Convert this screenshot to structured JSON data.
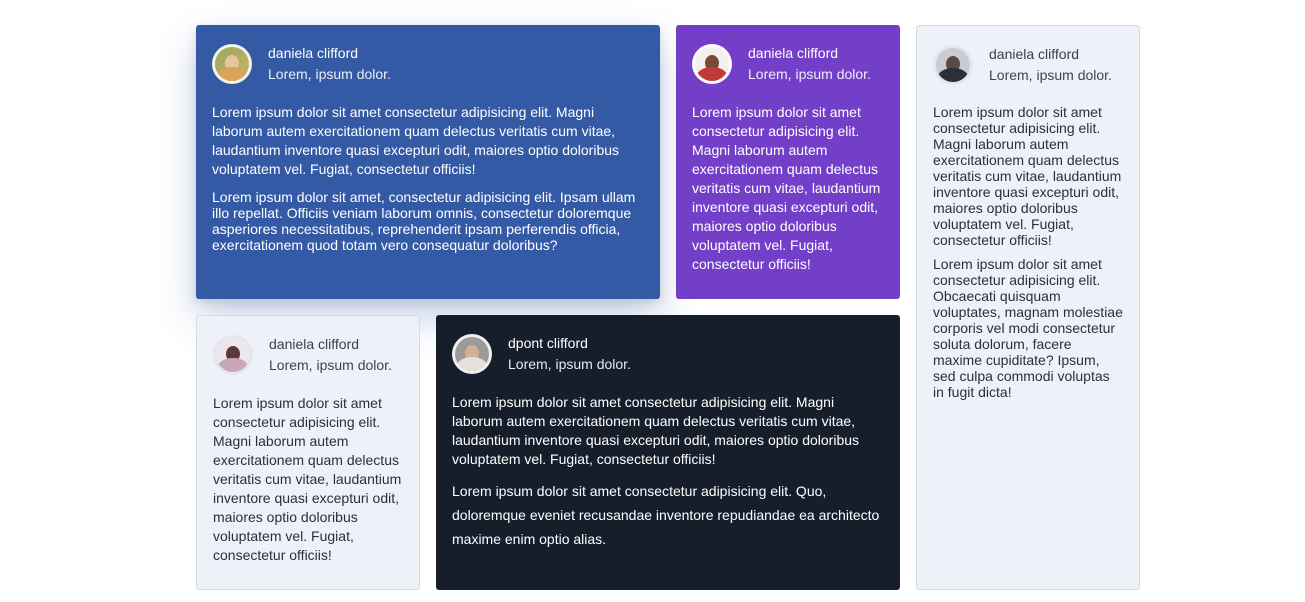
{
  "cards": [
    {
      "name": "daniela clifford",
      "handle": "Lorem, ipsum dolor.",
      "avatar_icon": "avatar-woman-blonde",
      "paragraphs": [
        "Lorem ipsum dolor sit amet consectetur adipisicing elit. Magni laborum autem exercitationem quam delectus veritatis cum vitae, laudantium inventore quasi excepturi odit, maiores optio doloribus voluptatem vel. Fugiat, consectetur officiis!",
        "Lorem ipsum dolor sit amet, consectetur adipisicing elit. Ipsam ullam illo repellat. Officiis veniam laborum omnis, consectetur doloremque asperiores necessitatibus, reprehenderit ipsam perferendis officia, exercitationem quod totam vero consequatur doloribus?"
      ]
    },
    {
      "name": "daniela clifford",
      "handle": "Lorem, ipsum dolor.",
      "avatar_icon": "avatar-woman-red",
      "paragraphs": [
        "Lorem ipsum dolor sit amet consectetur adipisicing elit. Magni laborum autem exercitationem quam delectus veritatis cum vitae, laudantium inventore quasi excepturi odit, maiores optio doloribus voluptatem vel. Fugiat, consectetur officiis!"
      ]
    },
    {
      "name": "daniela clifford",
      "handle": "Lorem, ipsum dolor.",
      "avatar_icon": "avatar-man-bald",
      "paragraphs": [
        "Lorem ipsum dolor sit amet consectetur adipisicing elit. Magni laborum autem exercitationem quam delectus veritatis cum vitae, laudantium inventore quasi excepturi odit, maiores optio doloribus voluptatem vel. Fugiat, consectetur officiis!",
        "Lorem ipsum dolor sit amet consectetur adipisicing elit. Obcaecati quisquam voluptates, magnam molestiae corporis vel modi consectetur soluta dolorum, facere maxime cupiditate? Ipsum, sed culpa commodi voluptas in fugit dicta!"
      ]
    },
    {
      "name": "daniela clifford",
      "handle": "Lorem, ipsum dolor.",
      "avatar_icon": "avatar-woman-dark-hair",
      "paragraphs": [
        "Lorem ipsum dolor sit amet consectetur adipisicing elit. Magni laborum autem exercitationem quam delectus veritatis cum vitae, laudantium inventore quasi excepturi odit, maiores optio doloribus voluptatem vel. Fugiat, consectetur officiis!"
      ]
    },
    {
      "name": "dpont clifford",
      "handle": "Lorem, ipsum dolor.",
      "avatar_icon": "avatar-man-bearded",
      "paragraphs": [
        "Lorem ipsum dolor sit amet consectetur adipisicing elit. Magni laborum autem exercitationem quam delectus veritatis cum vitae, laudantium inventore quasi excepturi odit, maiores optio doloribus voluptatem vel. Fugiat, consectetur officiis!",
        "Lorem ipsum dolor sit amet consectetur adipisicing elit. Quo, doloremque eveniet recusandae inventore repudiandae ea architecto maxime enim optio alias."
      ]
    }
  ],
  "colors": {
    "blue_card": "#3459a5",
    "purple_card": "#733fc8",
    "light_card": "#eef2f8",
    "dark_card": "#161d2b"
  }
}
